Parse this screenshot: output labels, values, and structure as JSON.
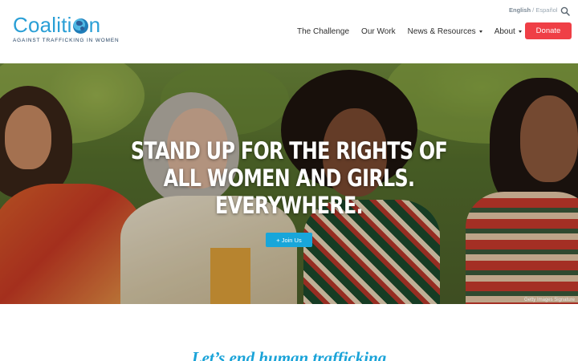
{
  "logo": {
    "word_before": "Coaliti",
    "word_after": "n",
    "tagline": "AGAINST TRAFFICKING IN WOMEN",
    "globe_icon": "globe-icon"
  },
  "language": {
    "active": "English",
    "separator": " / ",
    "other": "Español"
  },
  "search": {
    "icon": "search-icon"
  },
  "nav": {
    "items": [
      {
        "label": "The Challenge",
        "dropdown": false
      },
      {
        "label": "Our Work",
        "dropdown": false
      },
      {
        "label": "News & Resources",
        "dropdown": true
      },
      {
        "label": "About",
        "dropdown": true
      }
    ]
  },
  "donate": {
    "label": "Donate",
    "color": "#ef3f46"
  },
  "hero": {
    "line1": "STAND UP FOR THE RIGHTS OF",
    "line2": "ALL WOMEN AND GIRLS.",
    "line3": "EVERYWHERE.",
    "cta": "+ Join Us",
    "cta_color": "#18a6da",
    "credit": "Getty Images Signature"
  },
  "section": {
    "heading": "Let’s end human trafficking"
  },
  "colors": {
    "brand_blue": "#2a9fd6",
    "accent_red": "#ef3f46"
  }
}
